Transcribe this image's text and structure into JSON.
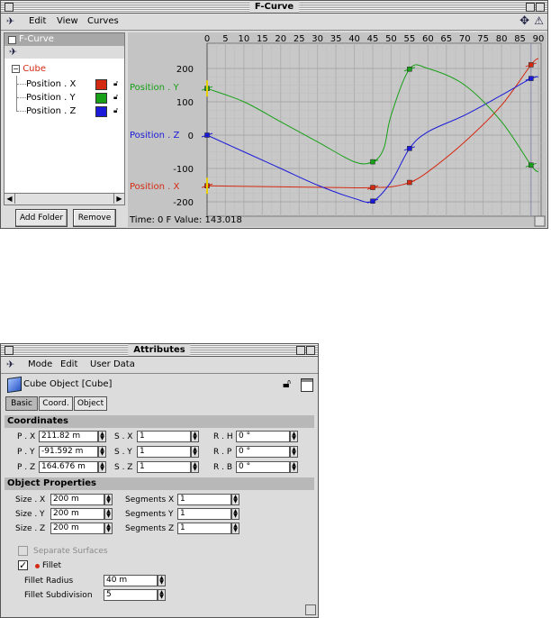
{
  "fcurve": {
    "title": "F-Curve",
    "menus": [
      "Edit",
      "View",
      "Curves"
    ],
    "panel_title": "F-Curve",
    "tree_root": "Cube",
    "tracks": [
      {
        "label": "Position . X",
        "color": "#d42a12"
      },
      {
        "label": "Position . Y",
        "color": "#18a018"
      },
      {
        "label": "Position . Z",
        "color": "#1a1ad8"
      }
    ],
    "add_folder": "Add Folder",
    "remove": "Remove",
    "status": "Time: 0 F Value: 143.018",
    "frame_ticks": [
      "0",
      "5",
      "10",
      "15",
      "20",
      "25",
      "30",
      "35",
      "40",
      "45",
      "50",
      "55",
      "60",
      "65",
      "70",
      "75",
      "80",
      "85",
      "90"
    ],
    "value_ticks": [
      "200",
      "100",
      "0",
      "-100",
      "-200"
    ],
    "curve_labels": {
      "y": "Position . Y",
      "z": "Position . Z",
      "x": "Position . X"
    },
    "curves": {
      "y": {
        "color": "#18a018",
        "points": [
          [
            0,
            140
          ],
          [
            10,
            100
          ],
          [
            20,
            40
          ],
          [
            30,
            -20
          ],
          [
            40,
            -80
          ],
          [
            45,
            -80
          ],
          [
            48,
            -40
          ],
          [
            50,
            60
          ],
          [
            55,
            198
          ],
          [
            60,
            200
          ],
          [
            70,
            150
          ],
          [
            80,
            40
          ],
          [
            88,
            -90
          ],
          [
            90,
            -110
          ]
        ]
      },
      "z": {
        "color": "#1a1ad8",
        "points": [
          [
            0,
            0
          ],
          [
            10,
            -50
          ],
          [
            20,
            -100
          ],
          [
            30,
            -150
          ],
          [
            40,
            -190
          ],
          [
            45,
            -198
          ],
          [
            50,
            -140
          ],
          [
            55,
            -40
          ],
          [
            60,
            10
          ],
          [
            70,
            60
          ],
          [
            80,
            120
          ],
          [
            88,
            170
          ],
          [
            90,
            175
          ]
        ]
      },
      "x": {
        "color": "#d42a12",
        "points": [
          [
            0,
            -152
          ],
          [
            20,
            -155
          ],
          [
            40,
            -158
          ],
          [
            45,
            -157
          ],
          [
            50,
            -155
          ],
          [
            55,
            -142
          ],
          [
            60,
            -110
          ],
          [
            70,
            -20
          ],
          [
            80,
            90
          ],
          [
            88,
            211
          ],
          [
            90,
            230
          ]
        ]
      }
    },
    "keys": {
      "y": [
        [
          0,
          140
        ],
        [
          45,
          -80
        ],
        [
          55,
          198
        ],
        [
          88,
          -90
        ]
      ],
      "z": [
        [
          0,
          0
        ],
        [
          45,
          -198
        ],
        [
          55,
          -40
        ],
        [
          88,
          170
        ]
      ],
      "x": [
        [
          0,
          -152
        ],
        [
          45,
          -157
        ],
        [
          55,
          -142
        ],
        [
          88,
          211
        ]
      ]
    }
  },
  "attributes": {
    "title": "Attributes",
    "menus": [
      "Mode",
      "Edit",
      "User Data"
    ],
    "object_title": "Cube Object [Cube]",
    "tabs": [
      "Basic",
      "Coord.",
      "Object"
    ],
    "coord_section": "Coordinates",
    "coords": [
      [
        {
          "label": "P . X",
          "value": "211.82 m"
        },
        {
          "label": "S . X",
          "value": "1"
        },
        {
          "label": "R . H",
          "value": "0 °"
        }
      ],
      [
        {
          "label": "P . Y",
          "value": "-91.592 m"
        },
        {
          "label": "S . Y",
          "value": "1"
        },
        {
          "label": "R . P",
          "value": "0 °"
        }
      ],
      [
        {
          "label": "P . Z",
          "value": "164.676 m"
        },
        {
          "label": "S . Z",
          "value": "1"
        },
        {
          "label": "R . B",
          "value": "0 °"
        }
      ]
    ],
    "props_section": "Object Properties",
    "sizes": [
      {
        "label": "Size . X",
        "value": "200 m",
        "seg_label": "Segments X",
        "seg_value": "1"
      },
      {
        "label": "Size . Y",
        "value": "200 m",
        "seg_label": "Segments Y",
        "seg_value": "1"
      },
      {
        "label": "Size . Z",
        "value": "200 m",
        "seg_label": "Segments Z",
        "seg_value": "1"
      }
    ],
    "separate_surfaces": "Separate Surfaces",
    "fillet": "Fillet",
    "fillet_radius_label": "Fillet Radius",
    "fillet_radius": "40 m",
    "fillet_subdiv_label": "Fillet Subdivision",
    "fillet_subdiv": "5"
  }
}
